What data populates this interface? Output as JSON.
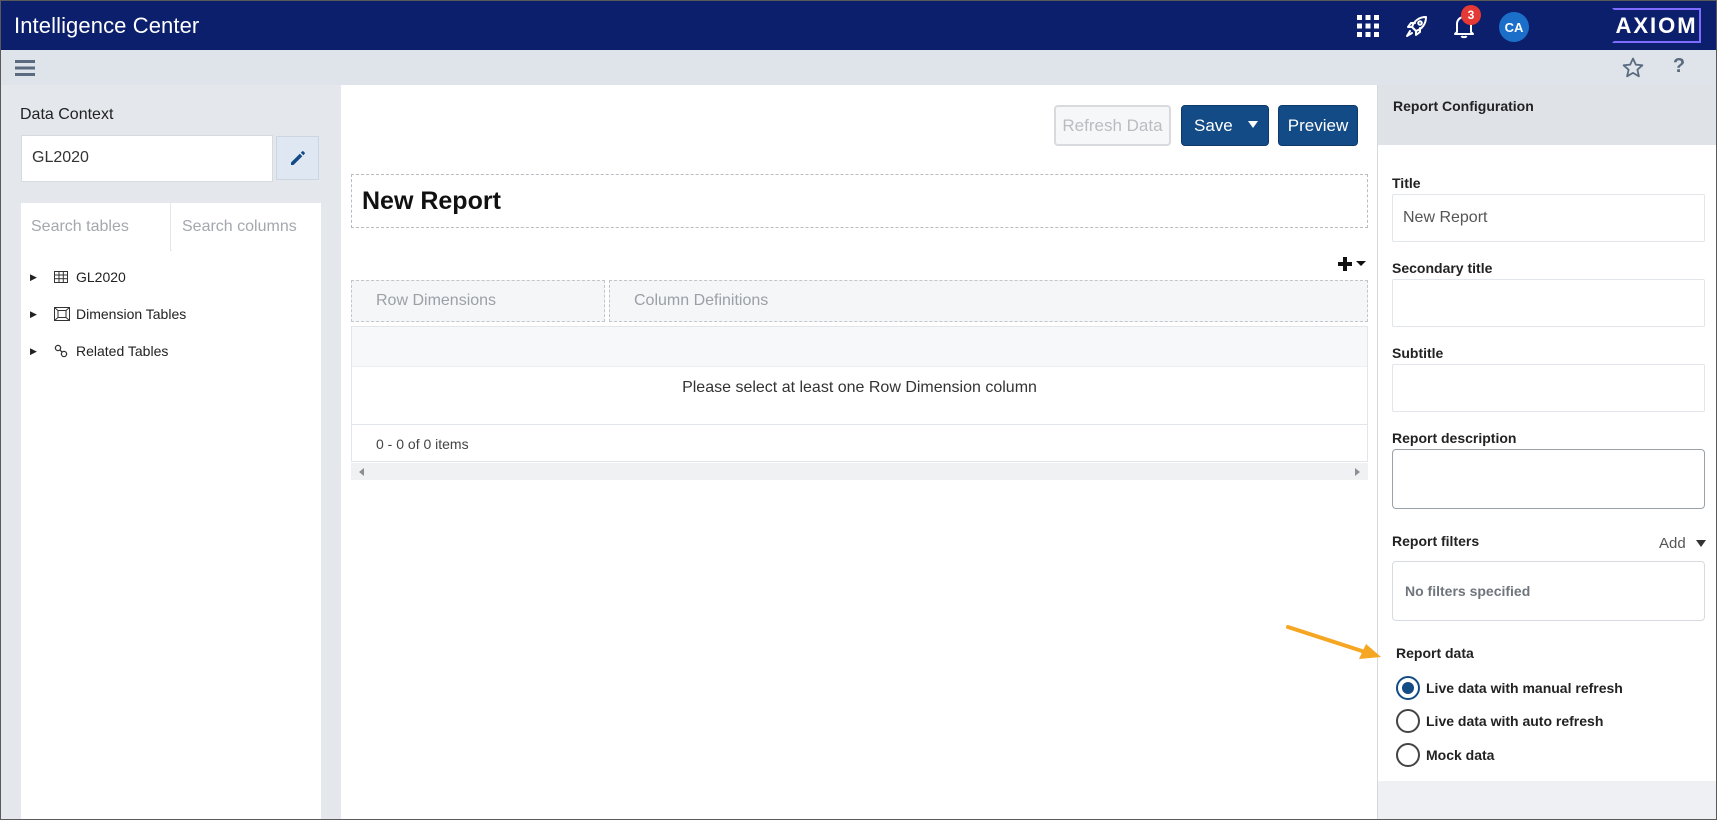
{
  "app": {
    "title": "Intelligence Center",
    "logo_text": "AXIOM"
  },
  "topbar": {
    "notification_count": "3",
    "avatar_initials": "CA",
    "icons": [
      "apps-grid-icon",
      "rocket-icon",
      "bell-icon"
    ]
  },
  "subbar": {
    "icons": [
      "hamburger-menu-icon",
      "star-icon",
      "help-icon"
    ],
    "help_glyph": "?"
  },
  "left_panel": {
    "data_context_label": "Data Context",
    "data_context_value": "GL2020",
    "search_tables_placeholder": "Search tables",
    "search_columns_placeholder": "Search columns",
    "tree": [
      {
        "label": "GL2020",
        "icon": "table-icon"
      },
      {
        "label": "Dimension Tables",
        "icon": "dimension-table-icon"
      },
      {
        "label": "Related Tables",
        "icon": "link-icon"
      }
    ]
  },
  "center": {
    "buttons": {
      "refresh": "Refresh Data",
      "save": "Save",
      "preview": "Preview"
    },
    "report_title": "New Report",
    "row_dimensions": "Row Dimensions",
    "column_definitions": "Column Definitions",
    "empty_message": "Please select at least one Row Dimension column",
    "pager_text": "0 - 0 of 0 items"
  },
  "right_panel": {
    "header": "Report Configuration",
    "title_label": "Title",
    "title_value": "New Report",
    "secondary_title_label": "Secondary title",
    "subtitle_label": "Subtitle",
    "description_label": "Report description",
    "filters_label": "Report filters",
    "filters_add": "Add",
    "filters_empty": "No filters specified",
    "report_data_label": "Report data",
    "report_data_options": [
      {
        "label": "Live data with manual refresh",
        "checked": true
      },
      {
        "label": "Live data with auto refresh",
        "checked": false
      },
      {
        "label": "Mock data",
        "checked": false
      }
    ]
  },
  "colors": {
    "topbar": "#0c1f6c",
    "primary_button": "#134b86",
    "badge": "#e53935",
    "avatar": "#1b6fc9",
    "annotation_arrow": "#f5a623"
  }
}
